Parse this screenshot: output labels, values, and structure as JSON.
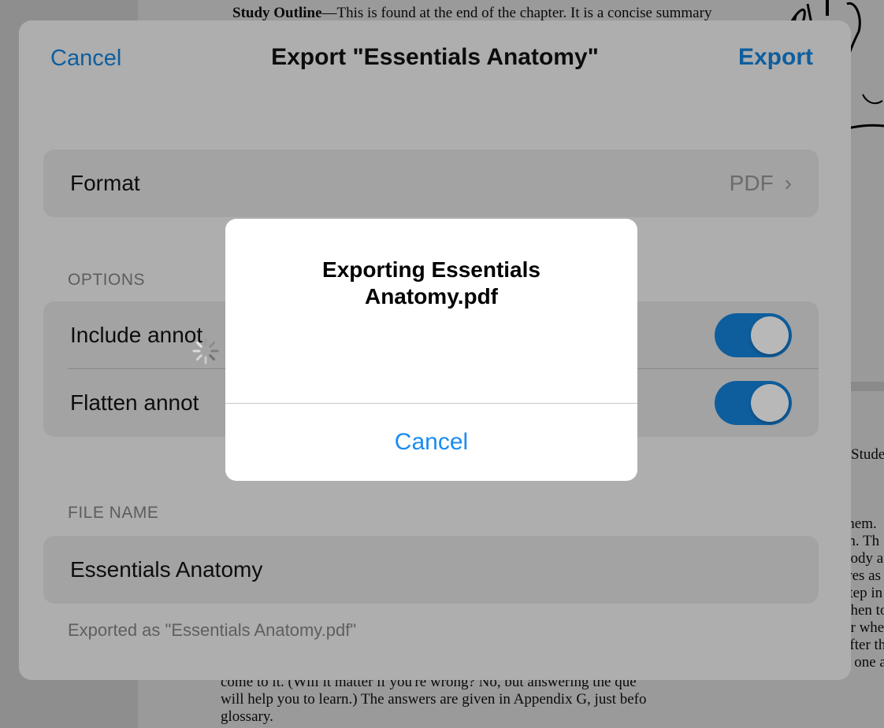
{
  "background_doc": {
    "top_line_bold": "Study Outline",
    "top_line_rest": "—This is found at the end of the chapter. It is a concise summary",
    "right_heading": ": Studer",
    "right_lines": [
      "them.",
      "rn. Th",
      "body a",
      "ires as",
      "step in",
      "vhen to",
      "or whe",
      "after th",
      "h one a"
    ],
    "bottom_lines": [
      "come to it. (Will it matter if you're wrong? No, but answering the que",
      "will help you to learn.) The answers are given in Appendix G, just befo",
      "glossary."
    ]
  },
  "sheet": {
    "cancel_label": "Cancel",
    "title": "Export \"Essentials Anatomy\"",
    "export_label": "Export",
    "format_label": "Format",
    "format_value": "PDF",
    "options_header": "OPTIONS",
    "options": [
      {
        "label": "Include annotations",
        "visible_label": "Include annot",
        "on": true
      },
      {
        "label": "Flatten annotations",
        "visible_label": "Flatten annot",
        "on": true
      }
    ],
    "file_name_header": "FILE NAME",
    "file_name_value": "Essentials Anatomy",
    "file_name_footnote": "Exported as \"Essentials Anatomy.pdf\""
  },
  "alert": {
    "title_line1": "Exporting Essentials",
    "title_line2": "Anatomy.pdf",
    "cancel_label": "Cancel"
  },
  "colors": {
    "accent": "#1a8cf0",
    "dimmed_accent": "#0e5e9e"
  }
}
